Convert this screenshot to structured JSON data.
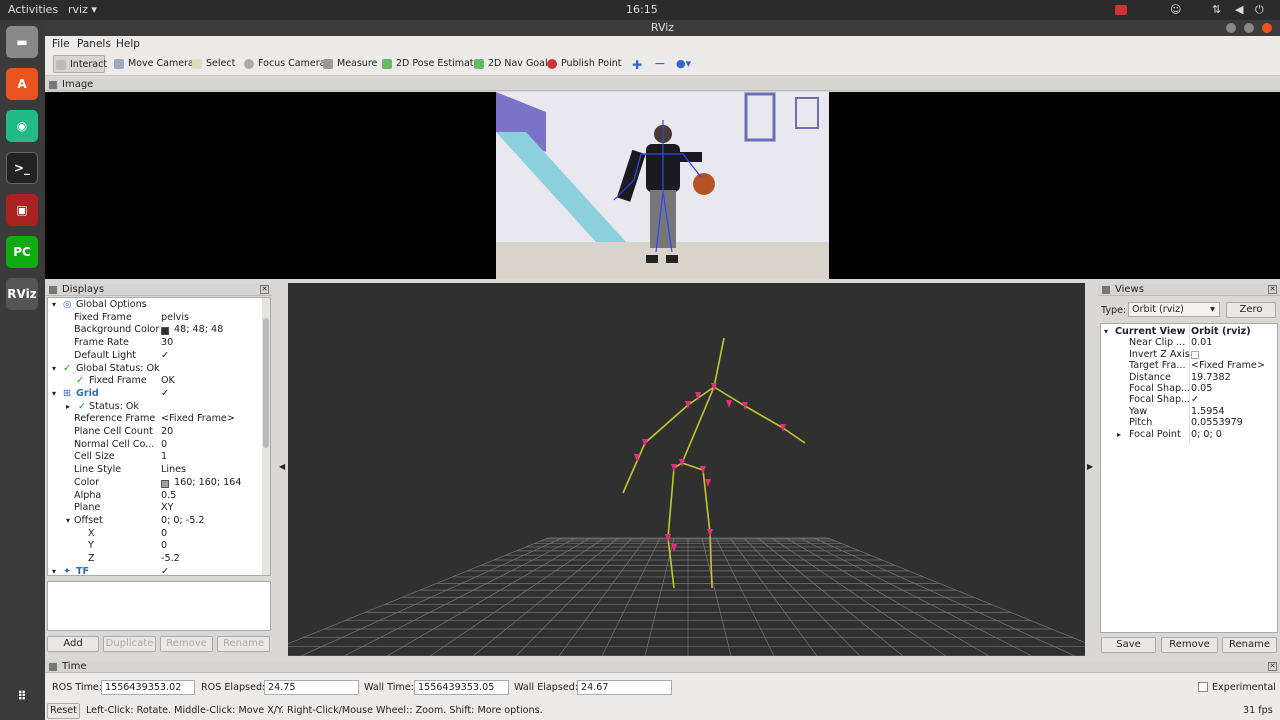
{
  "topbar": {
    "activities": "Activities",
    "app": "rviz ▾",
    "clock": "16:15"
  },
  "window": {
    "title": "RViz"
  },
  "menu": [
    "File",
    "Panels",
    "Help"
  ],
  "toolbar": [
    "Interact",
    "Move Camera",
    "Select",
    "Focus Camera",
    "Measure",
    "2D Pose Estimate",
    "2D Nav Goal",
    "Publish Point"
  ],
  "image_panel": {
    "title": "Image"
  },
  "displays": {
    "title": "Displays",
    "rows": [
      {
        "k": "Global Options",
        "v": "",
        "indent": 0
      },
      {
        "k": "Fixed Frame",
        "v": "pelvis",
        "indent": 1
      },
      {
        "k": "Background Color",
        "v": "48; 48; 48",
        "indent": 1
      },
      {
        "k": "Frame Rate",
        "v": "30",
        "indent": 1
      },
      {
        "k": "Default Light",
        "v": "✓",
        "indent": 1
      },
      {
        "k": "Global Status: Ok",
        "v": "",
        "indent": 0
      },
      {
        "k": "Fixed Frame",
        "v": "OK",
        "indent": 1
      },
      {
        "k": "Grid",
        "v": "✓",
        "indent": 0
      },
      {
        "k": "Status: Ok",
        "v": "",
        "indent": 1
      },
      {
        "k": "Reference Frame",
        "v": "<Fixed Frame>",
        "indent": 1
      },
      {
        "k": "Plane Cell Count",
        "v": "20",
        "indent": 1
      },
      {
        "k": "Normal Cell Co...",
        "v": "0",
        "indent": 1
      },
      {
        "k": "Cell Size",
        "v": "1",
        "indent": 1
      },
      {
        "k": "Line Style",
        "v": "Lines",
        "indent": 1
      },
      {
        "k": "Color",
        "v": "160; 160; 164",
        "indent": 1
      },
      {
        "k": "Alpha",
        "v": "0.5",
        "indent": 1
      },
      {
        "k": "Plane",
        "v": "XY",
        "indent": 1
      },
      {
        "k": "Offset",
        "v": "0; 0; -5.2",
        "indent": 1
      },
      {
        "k": "X",
        "v": "0",
        "indent": 2
      },
      {
        "k": "Y",
        "v": "0",
        "indent": 2
      },
      {
        "k": "Z",
        "v": "-5.2",
        "indent": 2
      },
      {
        "k": "TF",
        "v": "✓",
        "indent": 0
      }
    ],
    "buttons": [
      "Add",
      "Duplicate",
      "Remove",
      "Rename"
    ]
  },
  "views": {
    "title": "Views",
    "type_label": "Type:",
    "type_value": "Orbit (rviz)",
    "zero": "Zero",
    "rows": [
      {
        "k": "Current View",
        "v": "Orbit (rviz)"
      },
      {
        "k": "Near Clip ...",
        "v": "0.01"
      },
      {
        "k": "Invert Z Axis",
        "v": ""
      },
      {
        "k": "Target Fra...",
        "v": "<Fixed Frame>"
      },
      {
        "k": "Distance",
        "v": "19.7382"
      },
      {
        "k": "Focal Shap...",
        "v": "0.05"
      },
      {
        "k": "Focal Shap...",
        "v": "✓"
      },
      {
        "k": "Yaw",
        "v": "1.5954"
      },
      {
        "k": "Pitch",
        "v": "0.0553979"
      },
      {
        "k": "Focal Point",
        "v": "0; 0; 0"
      }
    ],
    "buttons": [
      "Save",
      "Remove",
      "Rename"
    ]
  },
  "time": {
    "title": "Time",
    "ros_time_label": "ROS Time:",
    "ros_time": "1556439353.02",
    "ros_elapsed_label": "ROS Elapsed:",
    "ros_elapsed": "24.75",
    "wall_time_label": "Wall Time:",
    "wall_time": "1556439353.05",
    "wall_elapsed_label": "Wall Elapsed:",
    "wall_elapsed": "24.67",
    "experimental": "Experimental",
    "reset": "Reset",
    "hint": "Left-Click: Rotate. Middle-Click: Move X/Y. Right-Click/Mouse Wheel:: Zoom. Shift: More options.",
    "fps": "31 fps"
  }
}
